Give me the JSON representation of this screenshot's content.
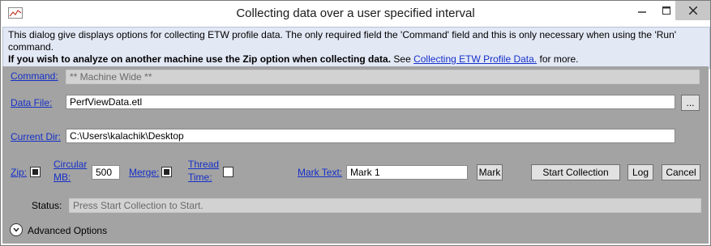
{
  "window": {
    "title": "Collecting data over a user specified interval",
    "icon": "chart-app-icon"
  },
  "info": {
    "line1": "This dialog give displays options for collecting ETW profile data. The only required field the 'Command' field and this is only necessary when using the 'Run' command.",
    "bold": "If you wish to analyze on another machine use the Zip option when collecting data.",
    "see": " See ",
    "link": "Collecting ETW Profile Data.",
    "tail": " for more."
  },
  "form": {
    "command_label": "Command:",
    "command_value": "** Machine Wide **",
    "datafile_label": "Data File:",
    "datafile_value": "PerfViewData.etl",
    "browse_label": "...",
    "curdir_label": "Current Dir:",
    "curdir_value": "C:\\Users\\kalachik\\Desktop",
    "zip_label": "Zip:",
    "zip_checked": true,
    "circular_label_1": "Circular",
    "circular_label_2": "MB:",
    "circular_value": "500",
    "merge_label": "Merge:",
    "merge_checked": true,
    "thread_label_1": "Thread",
    "thread_label_2": "Time:",
    "thread_checked": false,
    "marktext_label": "Mark Text:",
    "marktext_value": "Mark 1",
    "mark_button": "Mark",
    "start_button": "Start Collection",
    "log_button": "Log",
    "cancel_button": "Cancel",
    "status_label": "Status:",
    "status_value": "Press Start Collection to Start.",
    "advanced_label": "Advanced Options"
  },
  "colors": {
    "link": "#1530c8",
    "panel": "#a3a3a3",
    "info_bg": "#e3e8f5",
    "close_btn": "#c7c7c7"
  }
}
